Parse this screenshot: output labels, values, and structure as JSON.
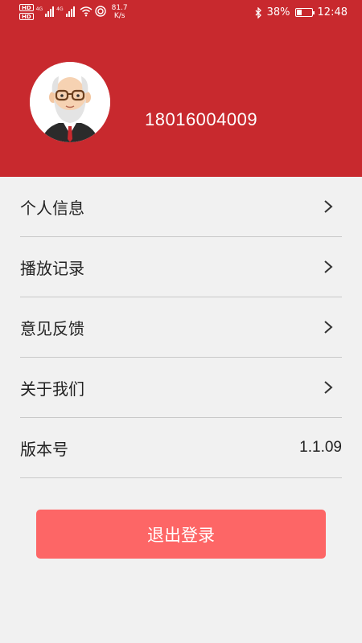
{
  "status_bar": {
    "hd_badge_1": "HD",
    "hd_badge_2": "HD",
    "network_1": "4G",
    "network_2": "4G",
    "speed_value": "81.7",
    "speed_unit": "K/s",
    "battery_percent": "38%",
    "battery_level": 0.38,
    "time": "12:48"
  },
  "profile": {
    "phone_number": "18016004009",
    "avatar_icon": "old-man-avatar-icon"
  },
  "menu": {
    "items": [
      {
        "label": "个人信息",
        "icon": "chevron-right-icon"
      },
      {
        "label": "播放记录",
        "icon": "chevron-right-icon"
      },
      {
        "label": "意见反馈",
        "icon": "chevron-right-icon"
      },
      {
        "label": "关于我们",
        "icon": "chevron-right-icon"
      }
    ],
    "version": {
      "label": "版本号",
      "value": "1.1.09"
    }
  },
  "logout": {
    "label": "退出登录"
  },
  "colors": {
    "header_bg": "#c8292e",
    "page_bg": "#f1f1f1",
    "logout_bg": "#fd6666"
  }
}
